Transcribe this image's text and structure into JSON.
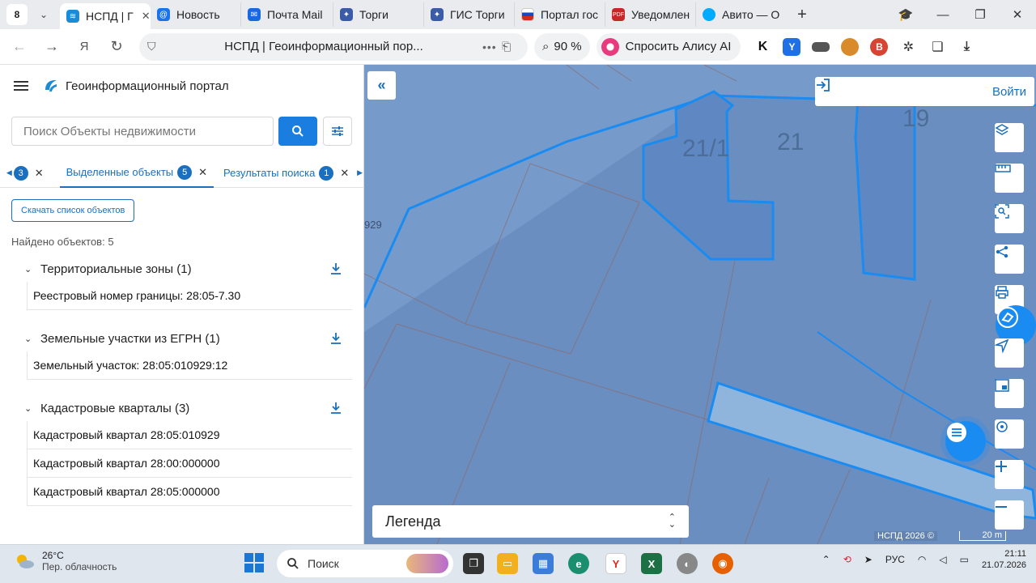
{
  "browser": {
    "tab_count": "8",
    "tabs": [
      {
        "label": "НСПД | Г",
        "active": true,
        "color": "#1b8bd6",
        "glyph": "≋"
      },
      {
        "label": "Новость",
        "color": "#1a73e8",
        "glyph": "@"
      },
      {
        "label": "Почта Mail",
        "color": "#1769e0",
        "glyph": "✉"
      },
      {
        "label": "Торги",
        "color": "#3a5ba8",
        "glyph": "✦"
      },
      {
        "label": "ГИС Торги",
        "color": "#3a5ba8",
        "glyph": "✦"
      },
      {
        "label": "Портал гос",
        "color": "#d52b1e",
        "glyph": "■"
      },
      {
        "label": "Уведомлен",
        "color": "#c62828",
        "glyph": "▤"
      },
      {
        "label": "Авито — О",
        "color": "#00aaff",
        "glyph": "●"
      }
    ],
    "url_title": "НСПД | Геоинформационный пор...",
    "zoom": "90 %",
    "alice_label": "Спросить Алису AI"
  },
  "panel": {
    "title": "Геоинформационный портал",
    "search_placeholder": "Поиск Объекты недвижимости",
    "tab_prev_badge": "3",
    "tabs": [
      {
        "label": "Выделенные объекты",
        "badge": "5"
      },
      {
        "label": "Результаты поиска",
        "badge": "1"
      }
    ],
    "download_list_label": "Скачать список объектов",
    "found_text": "Найдено объектов: 5",
    "groups": [
      {
        "title": "Территориальные зоны (1)",
        "rows": [
          "Реестровый номер границы: 28:05-7.30"
        ]
      },
      {
        "title": "Земельные участки из ЕГРН (1)",
        "rows": [
          "Земельный участок: 28:05:010929:12"
        ]
      },
      {
        "title": "Кадастровые кварталы (3)",
        "rows": [
          "Кадастровый квартал 28:05:010929",
          "Кадастровый квартал 28:00:000000",
          "Кадастровый квартал 28:05:000000"
        ]
      }
    ]
  },
  "map": {
    "login_label": "Войти",
    "legend_label": "Легенда",
    "labels": {
      "parcel_a": "21/1",
      "parcel_b": "21",
      "parcel_c": "19",
      "edge": "929"
    },
    "copyright": "НСПД 2026 ©",
    "scale": "20 m",
    "colors": {
      "accent": "#1a6fbf",
      "fill": "#6f92bd",
      "selected": "#1a8bf0"
    }
  },
  "taskbar": {
    "temperature": "26°C",
    "condition": "Пер. облачность",
    "search_label": "Поиск",
    "lang": "РУС",
    "time": "21:11",
    "date": "21.07.2026"
  }
}
